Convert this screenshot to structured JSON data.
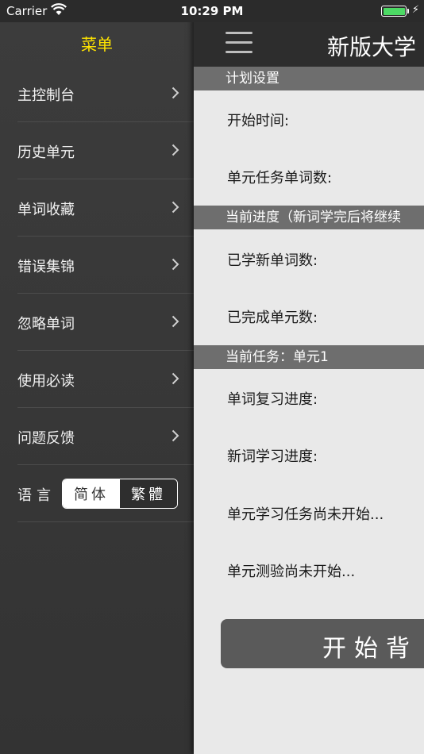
{
  "status_bar": {
    "carrier": "Carrier",
    "time": "10:29 PM"
  },
  "menu": {
    "title": "菜单",
    "items": [
      {
        "label": "主控制台"
      },
      {
        "label": "历史单元"
      },
      {
        "label": "单词收藏"
      },
      {
        "label": "错误集锦"
      },
      {
        "label": "忽略单词"
      },
      {
        "label": "使用必读"
      },
      {
        "label": "问题反馈"
      }
    ],
    "language": {
      "label": "语言",
      "options": [
        "简体",
        "繁體"
      ],
      "selected": "简体"
    }
  },
  "main": {
    "nav_title": "新版大学",
    "sections": {
      "plan": "计划设置",
      "progress": "当前进度（新词学完后将继续",
      "task": "当前任务：单元1"
    },
    "rows": {
      "start_time": "开始时间:",
      "unit_word_count": "单元任务单词数:",
      "learned_new_words": "已学新单词数:",
      "completed_units": "已完成单元数:",
      "review_progress": "单词复习进度:",
      "new_word_progress": "新词学习进度:",
      "unit_task_status": "单元学习任务尚未开始...",
      "unit_test_status": "单元测验尚未开始..."
    },
    "start_button": "开始背"
  },
  "colors": {
    "menu_title": "#ffe400",
    "battery": "#4cd964",
    "section_header": "#6e6e6e",
    "main_bg": "#e9e9e9"
  }
}
